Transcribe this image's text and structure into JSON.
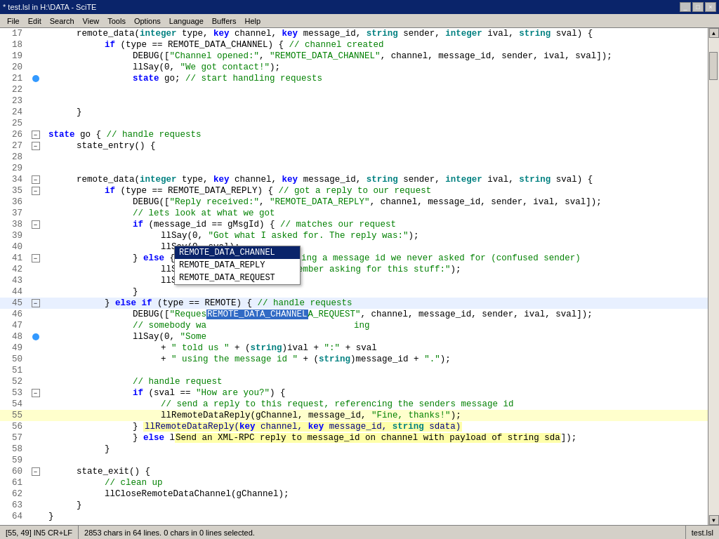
{
  "titlebar": {
    "title": "* test.lsl in H:\\DATA - SciTE",
    "buttons": [
      "_",
      "□",
      "×"
    ]
  },
  "menubar": {
    "items": [
      "File",
      "Edit",
      "Search",
      "View",
      "Tools",
      "Options",
      "Language",
      "Buffers",
      "Help"
    ]
  },
  "lines": [
    {
      "num": 17,
      "fold": "",
      "dot": false,
      "indent": 1,
      "content": "remote_data(<span class='type'>integer</span> type, <span class='kw'>key</span> channel, <span class='kw'>key</span> message_id, <span class='type'>string</span> sender, <span class='type'>integer</span> ival, <span class='type'>string</span> sval) {"
    },
    {
      "num": 18,
      "fold": "",
      "dot": false,
      "indent": 2,
      "content": "<span class='kw'>if</span> (type == REMOTE_DATA_CHANNEL) { <span class='comment'>// channel created</span>"
    },
    {
      "num": 19,
      "fold": "",
      "dot": false,
      "indent": 3,
      "content": "DEBUG([<span class='str'>\"Channel opened:\"</span>, <span class='str'>\"REMOTE_DATA_CHANNEL\"</span>, channel, message_id, sender, ival, sval]);"
    },
    {
      "num": 20,
      "fold": "",
      "dot": false,
      "indent": 3,
      "content": "llSay(0, <span class='str'>\"We got contact!\"</span>);"
    },
    {
      "num": 21,
      "fold": "",
      "dot": true,
      "indent": 3,
      "content": "<span class='kw'>state</span> go; <span class='comment'>// start handling requests</span>"
    },
    {
      "num": 22,
      "fold": "",
      "dot": false,
      "indent": 2,
      "content": ""
    },
    {
      "num": 23,
      "fold": "",
      "dot": false,
      "indent": 2,
      "content": ""
    },
    {
      "num": 24,
      "fold": "",
      "dot": false,
      "indent": 1,
      "content": "}"
    },
    {
      "num": 25,
      "fold": "",
      "dot": false,
      "indent": 0,
      "content": ""
    },
    {
      "num": 26,
      "fold": "minus",
      "dot": false,
      "indent": 0,
      "content": "<span class='kw'>state</span> go { <span class='comment'>// handle requests</span>"
    },
    {
      "num": 27,
      "fold": "minus",
      "dot": false,
      "indent": 1,
      "content": "state_entry() {"
    },
    {
      "num": 28,
      "fold": "",
      "dot": false,
      "indent": 0,
      "content": ""
    },
    {
      "num": 29,
      "fold": "",
      "dot": false,
      "indent": 0,
      "content": ""
    },
    {
      "num": 34,
      "fold": "minus",
      "dot": false,
      "indent": 1,
      "content": "remote_data(<span class='type'>integer</span> type, <span class='kw'>key</span> channel, <span class='kw'>key</span> message_id, <span class='type'>string</span> sender, <span class='type'>integer</span> ival, <span class='type'>string</span> sval) {"
    },
    {
      "num": 35,
      "fold": "minus",
      "dot": false,
      "indent": 2,
      "content": "<span class='kw'>if</span> (type == REMOTE_DATA_REPLY) { <span class='comment'>// got a reply to our request</span>"
    },
    {
      "num": 36,
      "fold": "",
      "dot": false,
      "indent": 3,
      "content": "DEBUG([<span class='str'>\"Reply received:\"</span>, <span class='str'>\"REMOTE_DATA_REPLY\"</span>, channel, message_id, sender, ival, sval]);"
    },
    {
      "num": 37,
      "fold": "",
      "dot": false,
      "indent": 3,
      "content": "<span class='comment'>// lets look at what we got</span>"
    },
    {
      "num": 38,
      "fold": "minus",
      "dot": false,
      "indent": 3,
      "content": "<span class='kw'>if</span> (message_id == gMsgId) { <span class='comment'>// matches our request</span>"
    },
    {
      "num": 39,
      "fold": "",
      "dot": false,
      "indent": 4,
      "content": "llSay(0, <span class='str'>\"Got what I asked for. The reply was:\"</span>);"
    },
    {
      "num": 40,
      "fold": "",
      "dot": false,
      "indent": 4,
      "content": "llSay(0, sval);"
    },
    {
      "num": 41,
      "fold": "minus",
      "dot": false,
      "indent": 3,
      "content": "} <span class='kw'>else</span> { <span class='comment'>// got a reply referencing a message id we never asked for (confused sender)</span>"
    },
    {
      "num": 42,
      "fold": "",
      "dot": false,
      "indent": 4,
      "content": "llSay(0, <span class='str'>\"Hmm, I don't remember asking for this stuff:\"</span>);"
    },
    {
      "num": 43,
      "fold": "",
      "dot": false,
      "indent": 4,
      "content": "llSay(0, sval);"
    },
    {
      "num": 44,
      "fold": "",
      "dot": false,
      "indent": 3,
      "content": "}"
    },
    {
      "num": 45,
      "fold": "minus",
      "dot": false,
      "indent": 2,
      "content": "} <span class='kw'>else if</span> (type == REMOTE) { <span class='comment'>// handle requests</span>"
    },
    {
      "num": 46,
      "fold": "",
      "dot": false,
      "indent": 3,
      "content": "DEBUG([<span class='str'>\"Reques</span><span style='background:#316ac5;color:white'>REMOTE_DATA_CHANNEL</span><span class='str'>A_REQUEST\"</span>, channel, message_id, sender, ival, sval]);"
    },
    {
      "num": 47,
      "fold": "",
      "dot": false,
      "indent": 3,
      "content": "<span class='comment'>// somebody wa</span><span class='comment'>                                          ing</span>"
    },
    {
      "num": 48,
      "fold": "",
      "dot": true,
      "indent": 3,
      "content": "llSay(0, <span class='str'>\"Some</span>"
    },
    {
      "num": 49,
      "fold": "",
      "dot": false,
      "indent": 4,
      "content": "+ <span class='str'>\" told us \"</span> + (<span class='type'>string</span>)ival + <span class='str'>\":\"</span> + sval"
    },
    {
      "num": 50,
      "fold": "",
      "dot": false,
      "indent": 4,
      "content": "+ <span class='str'>\" using the message id \"</span> + (<span class='type'>string</span>)message_id + <span class='str'>\".\"</span>);"
    },
    {
      "num": 51,
      "fold": "",
      "dot": false,
      "indent": 0,
      "content": ""
    },
    {
      "num": 52,
      "fold": "",
      "dot": false,
      "indent": 3,
      "content": "<span class='comment'>// handle request</span>"
    },
    {
      "num": 53,
      "fold": "minus",
      "dot": false,
      "indent": 3,
      "content": "<span class='kw'>if</span> (sval == <span class='str'>\"How are you?\"</span>) {"
    },
    {
      "num": 54,
      "fold": "",
      "dot": false,
      "indent": 4,
      "content": "<span class='comment'>// send a reply to this request, referencing the senders message id</span>"
    },
    {
      "num": 55,
      "fold": "",
      "dot": false,
      "indent": 4,
      "content": "llRemoteDataReply(gChannel, message_id, <span class='str'>\"Fine, thanks!\"</span>);"
    },
    {
      "num": 56,
      "fold": "",
      "dot": false,
      "indent": 3,
      "content": "<span style='background:#ffffaa'>llRemoteDataReply(<span class='kw'>key</span> channel, <span class='kw'>key</span> message_id, <span class='type'>string</span> sdata)</span>"
    },
    {
      "num": 57,
      "fold": "",
      "dot": false,
      "indent": 3,
      "content": "} <span class='kw'>else</span> l<span style='background:#ffffaa'>Send an XML-RPC reply to message_id on channel with payload of string sda</span>]);"
    },
    {
      "num": 58,
      "fold": "",
      "dot": false,
      "indent": 2,
      "content": "}"
    },
    {
      "num": 59,
      "fold": "",
      "dot": false,
      "indent": 0,
      "content": ""
    },
    {
      "num": 60,
      "fold": "minus",
      "dot": false,
      "indent": 1,
      "content": "state_exit() {"
    },
    {
      "num": 61,
      "fold": "",
      "dot": false,
      "indent": 2,
      "content": "<span class='comment'>// clean up</span>"
    },
    {
      "num": 62,
      "fold": "",
      "dot": false,
      "indent": 2,
      "content": "llCloseRemoteDataChannel(gChannel);"
    },
    {
      "num": 63,
      "fold": "",
      "dot": false,
      "indent": 1,
      "content": "}"
    },
    {
      "num": 64,
      "fold": "",
      "dot": false,
      "indent": 0,
      "content": "}"
    }
  ],
  "autocomplete": {
    "items": [
      "REMOTE_DATA_CHANNEL",
      "REMOTE_DATA_REPLY",
      "REMOTE_DATA_REQUEST"
    ],
    "selected": 0
  },
  "tooltip": {
    "text": "llRemoteDataReply(key channel, key message_id, string sdata)"
  },
  "statusbar": {
    "position": "[55, 49] IN5 CR+LF",
    "info": "2853 chars in 64 lines. 0 chars in 0 lines selected.",
    "file": "test.lsl"
  }
}
